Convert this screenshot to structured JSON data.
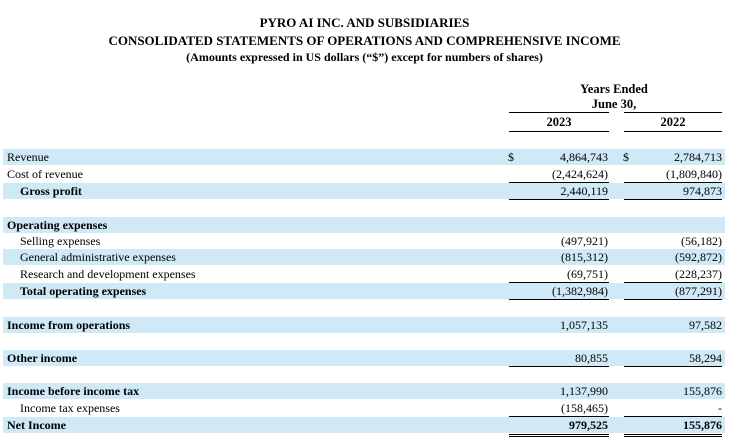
{
  "header": {
    "company": "PYRO AI INC. AND SUBSIDIARIES",
    "statement": "CONSOLIDATED STATEMENTS OF OPERATIONS AND COMPREHENSIVE INCOME",
    "note": "(Amounts expressed in US dollars (“$”) except for numbers of shares)",
    "period_line1": "Years Ended",
    "period_line2": "June 30,",
    "col1": "2023",
    "col2": "2022"
  },
  "currency_symbol": "$",
  "rows": {
    "revenue": {
      "label": "Revenue",
      "v2023": "4,864,743",
      "v2022": "2,784,713"
    },
    "cost_of_revenue": {
      "label": "Cost of revenue",
      "v2023": "(2,424,624)",
      "v2022": "(1,809,840)"
    },
    "gross_profit": {
      "label": "Gross profit",
      "v2023": "2,440,119",
      "v2022": "974,873"
    },
    "opex_heading": {
      "label": "Operating expenses"
    },
    "selling": {
      "label": "Selling expenses",
      "v2023": "(497,921)",
      "v2022": "(56,182)"
    },
    "general_admin": {
      "label": "General administrative expenses",
      "v2023": "(815,312)",
      "v2022": "(592,872)"
    },
    "rnd": {
      "label": "Research and development expenses",
      "v2023": "(69,751)",
      "v2022": "(228,237)"
    },
    "total_opex": {
      "label": "Total operating expenses",
      "v2023": "(1,382,984)",
      "v2022": "(877,291)"
    },
    "income_ops": {
      "label": "Income from operations",
      "v2023": "1,057,135",
      "v2022": "97,582"
    },
    "other_income": {
      "label": "Other income",
      "v2023": "80,855",
      "v2022": "58,294"
    },
    "income_before_tax": {
      "label": "Income before income tax",
      "v2023": "1,137,990",
      "v2022": "155,876"
    },
    "income_tax": {
      "label": "Income tax expenses",
      "v2023": "(158,465)",
      "v2022": "-"
    },
    "net_income": {
      "label": "Net Income",
      "v2023": "979,525",
      "v2022": "155,876"
    }
  }
}
